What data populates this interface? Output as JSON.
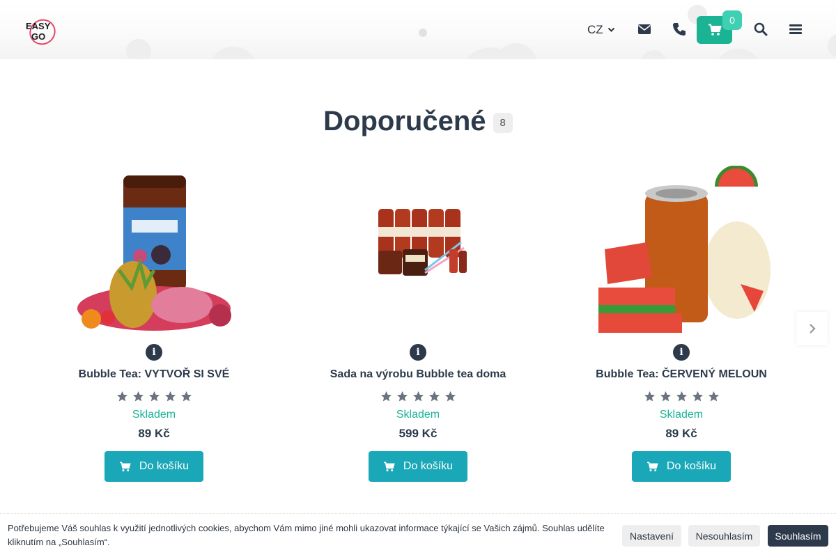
{
  "header": {
    "logo_line1": "EASY",
    "logo_line2": "GO",
    "language": "CZ",
    "cart_count": "0"
  },
  "section": {
    "title": "Doporučené",
    "count": "8"
  },
  "products": [
    {
      "name": "Bubble Tea: VYTVOŘ SI SVÉ",
      "stock": "Skladem",
      "price": "89 Kč",
      "button": "Do košíku",
      "rating": 0
    },
    {
      "name": "Sada na výrobu Bubble tea doma",
      "stock": "Skladem",
      "price": "599 Kč",
      "button": "Do košíku",
      "rating": 0
    },
    {
      "name": "Bubble Tea: ČERVENÝ MELOUN",
      "stock": "Skladem",
      "price": "89 Kč",
      "button": "Do košíku",
      "rating": 0
    }
  ],
  "cookie": {
    "text": "Potřebujeme Váš souhlas k využití jednotlivých cookies, abychom Vám mimo jiné mohli ukazovat informace týkající se Vašich zájmů. Souhlas udělíte kliknutím na „Souhlasím“.",
    "settings": "Nastavení",
    "reject": "Nesouhlasím",
    "accept": "Souhlasím"
  },
  "colors": {
    "accent": "#1ab394",
    "button": "#1aa7b8",
    "dark": "#2c3a4b"
  }
}
